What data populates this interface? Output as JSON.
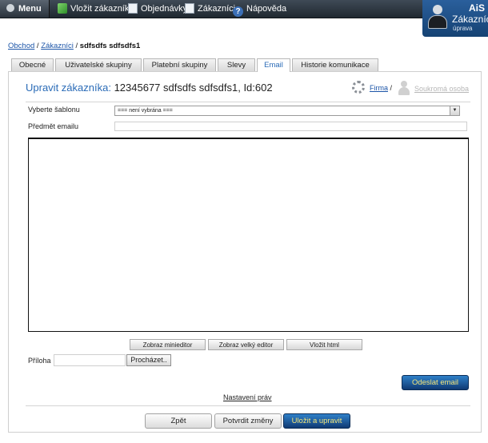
{
  "topbar": {
    "menu_label": "Menu",
    "items": [
      {
        "label": "Vložit zákazníka",
        "icon": "add-user-icon"
      },
      {
        "label": "Objednávky",
        "icon": "document-icon"
      },
      {
        "label": "Zákazníci",
        "icon": "document-icon"
      },
      {
        "label": "Nápověda",
        "icon": "help-icon"
      }
    ],
    "help_glyph": "?"
  },
  "brand": {
    "logo": "AiS",
    "title": "Zákazníci",
    "subtitle": "úprava"
  },
  "breadcrumb": {
    "items": [
      "Obchod",
      "Zákazníci"
    ],
    "separator": " / ",
    "current": "sdfsdfs sdfsdfs1"
  },
  "tabs": [
    {
      "label": "Obecné",
      "active": false
    },
    {
      "label": "Uživatelské skupiny",
      "active": false
    },
    {
      "label": "Platební skupiny",
      "active": false
    },
    {
      "label": "Slevy",
      "active": false
    },
    {
      "label": "Email",
      "active": true
    },
    {
      "label": "Historie komunikace",
      "active": false
    }
  ],
  "heading": {
    "prefix": "Upravit zákazníka:",
    "name": "12345677 sdfsdfs sdfsdfs1, Id:602"
  },
  "customer_type": {
    "firma": "Firma",
    "separator": "/",
    "person": "Soukromá osoba"
  },
  "form": {
    "template_label": "Vyberte šablonu",
    "template_value": "=== není vybrána ===",
    "subject_label": "Předmět emailu",
    "subject_value": "",
    "attachment_label": "Příloha",
    "browse_label": "Procházet.."
  },
  "editor_buttons": {
    "mini": "Zobraz minieditor",
    "big": "Zobraz velký editor",
    "html": "Vložit html"
  },
  "actions": {
    "send": "Odeslat email",
    "rights": "Nastavení práv",
    "back": "Zpět",
    "confirm": "Potvrdit změny",
    "save": "Uložit a upravit"
  }
}
